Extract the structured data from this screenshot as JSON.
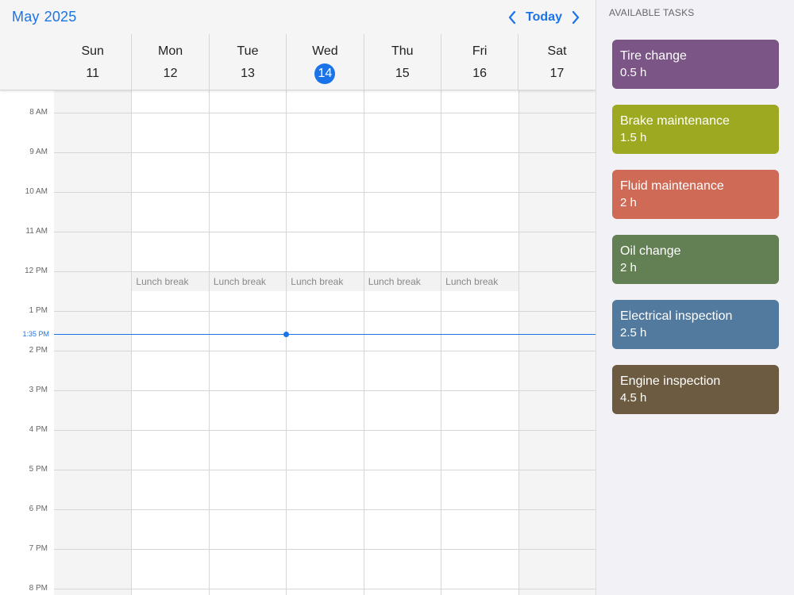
{
  "header": {
    "month": "May",
    "year": "2025",
    "today_label": "Today"
  },
  "days": [
    {
      "name": "Sun",
      "num": "11",
      "weekend": true,
      "today": false
    },
    {
      "name": "Mon",
      "num": "12",
      "weekend": false,
      "today": false
    },
    {
      "name": "Tue",
      "num": "13",
      "weekend": false,
      "today": false
    },
    {
      "name": "Wed",
      "num": "14",
      "weekend": false,
      "today": true
    },
    {
      "name": "Thu",
      "num": "15",
      "weekend": false,
      "today": false
    },
    {
      "name": "Fri",
      "num": "16",
      "weekend": false,
      "today": false
    },
    {
      "name": "Sat",
      "num": "17",
      "weekend": true,
      "today": false
    }
  ],
  "time_labels": [
    "8 AM",
    "9 AM",
    "10 AM",
    "11 AM",
    "12 PM",
    "1 PM",
    "2 PM",
    "3 PM",
    "4 PM",
    "5 PM",
    "6 PM",
    "7 PM",
    "8 PM"
  ],
  "lunch_label": "Lunch break",
  "now_label": "1:35 PM",
  "tasks_panel": {
    "title": "AVAILABLE TASKS",
    "tasks": [
      {
        "name": "Tire change",
        "duration": "0.5 h",
        "color": "#7a5585"
      },
      {
        "name": "Brake maintenance",
        "duration": "1.5 h",
        "color": "#9ea922"
      },
      {
        "name": "Fluid maintenance",
        "duration": "2 h",
        "color": "#cf6a56"
      },
      {
        "name": "Oil change",
        "duration": "2 h",
        "color": "#637f54"
      },
      {
        "name": "Electrical inspection",
        "duration": "2.5 h",
        "color": "#52799e"
      },
      {
        "name": "Engine inspection",
        "duration": "4.5 h",
        "color": "#6c5b40"
      }
    ]
  },
  "colors": {
    "accent": "#1a73e8"
  }
}
